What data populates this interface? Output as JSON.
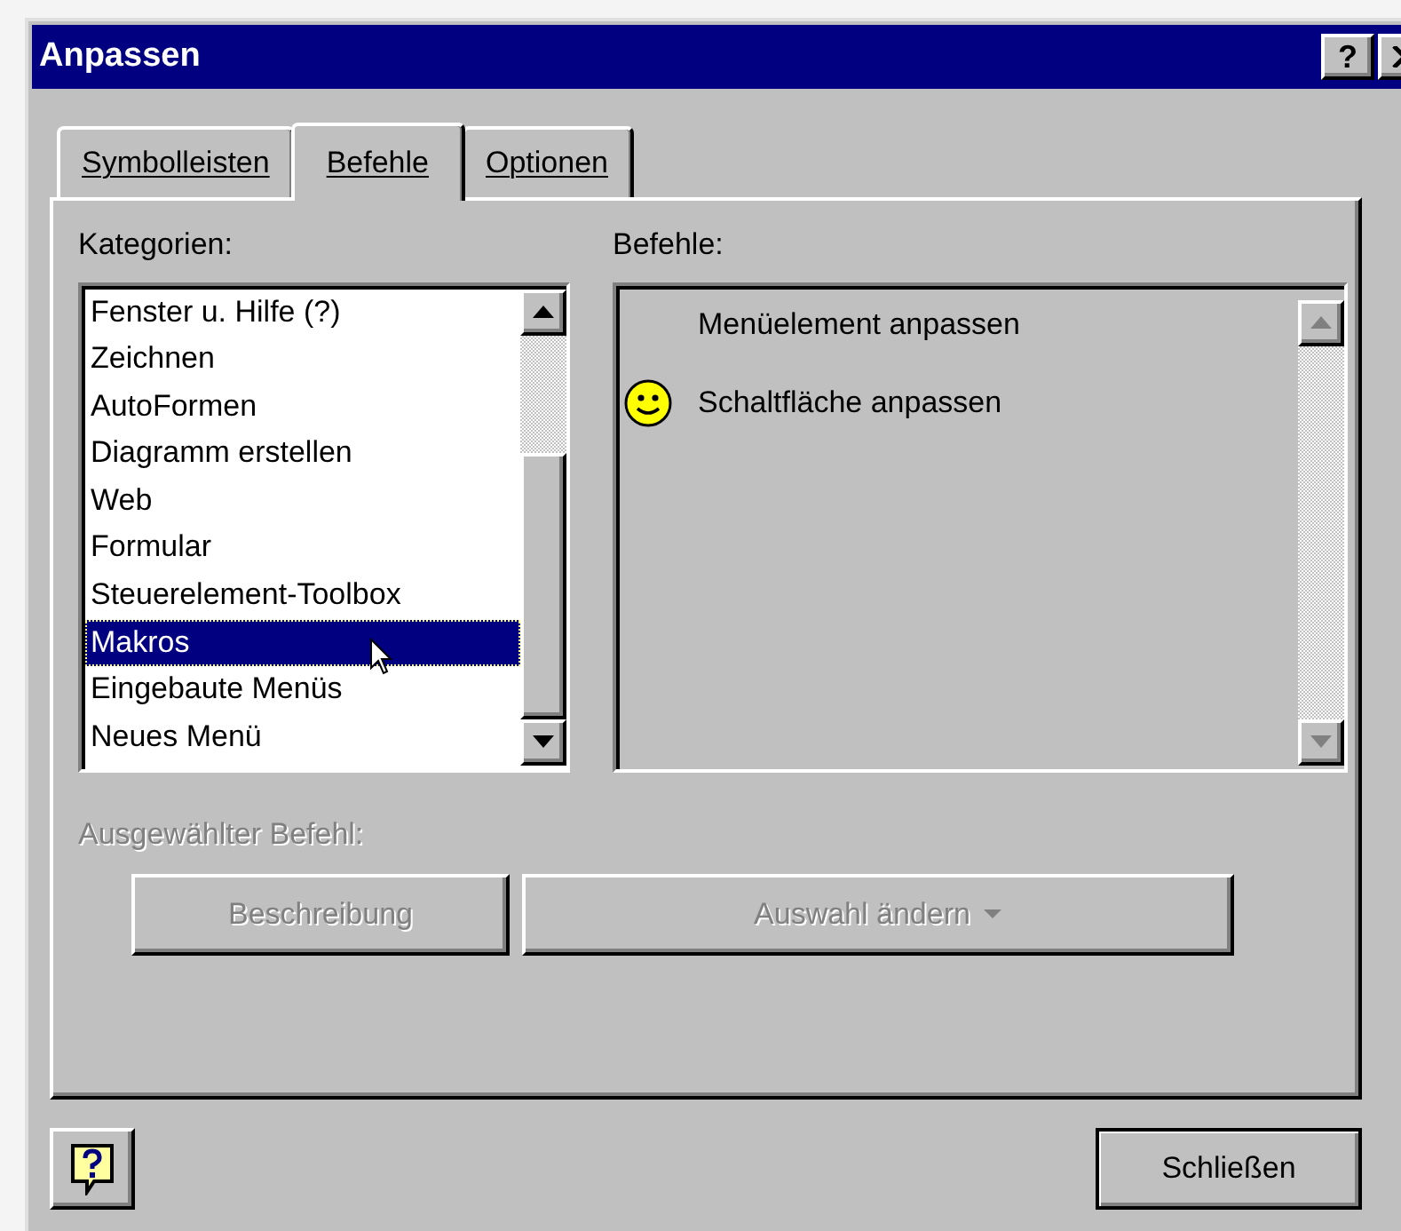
{
  "window": {
    "title": "Anpassen",
    "help_button": "?"
  },
  "tabs": [
    {
      "label": "Symbolleisten",
      "selected": false
    },
    {
      "label": "Befehle",
      "selected": true
    },
    {
      "label": "Optionen",
      "selected": false
    }
  ],
  "categories": {
    "label": "Kategorien:",
    "items": [
      {
        "label": "Fenster u. Hilfe (?)",
        "selected": false
      },
      {
        "label": "Zeichnen",
        "selected": false
      },
      {
        "label": "AutoFormen",
        "selected": false
      },
      {
        "label": "Diagramm erstellen",
        "selected": false
      },
      {
        "label": "Web",
        "selected": false
      },
      {
        "label": "Formular",
        "selected": false
      },
      {
        "label": "Steuerelement-Toolbox",
        "selected": false
      },
      {
        "label": "Makros",
        "selected": true
      },
      {
        "label": "Eingebaute Menüs",
        "selected": false
      },
      {
        "label": "Neues Menü",
        "selected": false
      }
    ]
  },
  "commands": {
    "label": "Befehle:",
    "items": [
      {
        "label": "Menüelement anpassen",
        "kind": "plain"
      },
      {
        "label": "Schaltfläche anpassen",
        "kind": "smiley"
      }
    ]
  },
  "selected_command": {
    "label": "Ausgewählter Befehl:",
    "disabled": true,
    "buttons": [
      {
        "label": "Beschreibung",
        "disabled": true,
        "kind": "plain"
      },
      {
        "label": "Auswahl ändern",
        "disabled": true,
        "kind": "dropdown"
      }
    ]
  },
  "close_button": "Schließen"
}
